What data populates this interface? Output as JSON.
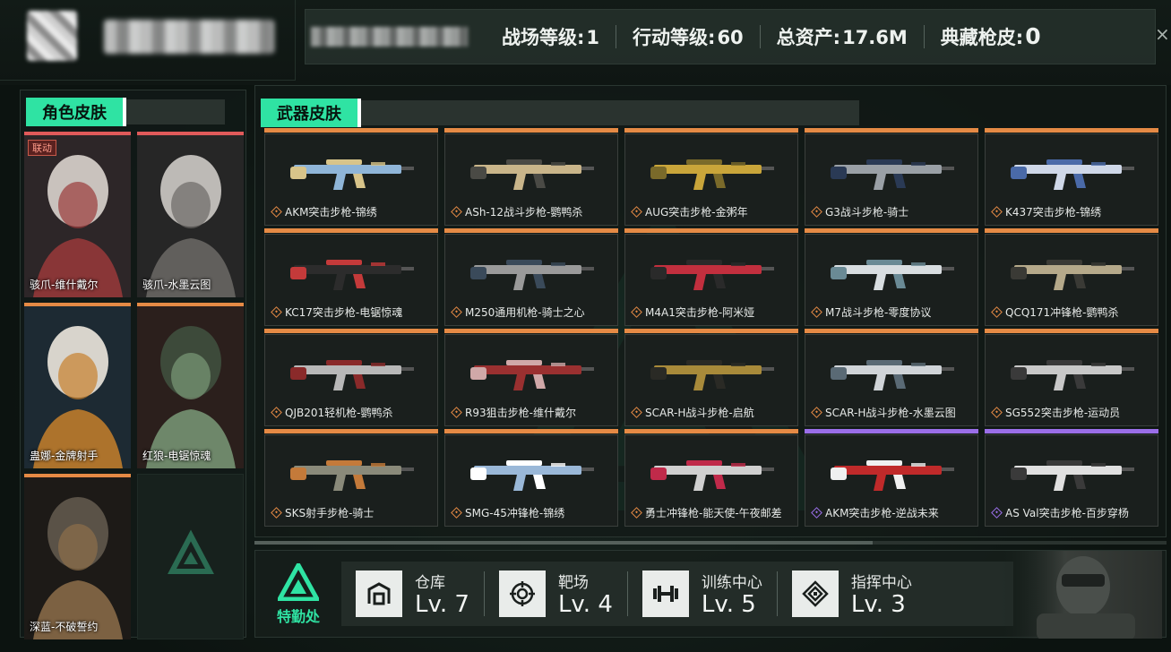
{
  "header": {
    "stats": [
      {
        "label": "战场等级:",
        "value": "1"
      },
      {
        "label": "行动等级:",
        "value": "60"
      },
      {
        "label": "总资产:",
        "value": "17.6M"
      },
      {
        "label": "典藏枪皮:",
        "value": "0"
      }
    ],
    "close_glyph": "×"
  },
  "character_section": {
    "title": "角色皮肤",
    "cards": [
      {
        "label": "骇爪-维什戴尔",
        "badge": "联动",
        "rarity_color": "#e05a5a"
      },
      {
        "label": "骇爪-水墨云图",
        "badge": "",
        "rarity_color": "#e05a5a"
      },
      {
        "label": "蛊娜-金牌射手",
        "badge": "",
        "rarity_color": "#e58a45"
      },
      {
        "label": "红狼-电锯惊魂",
        "badge": "",
        "rarity_color": "#e58a45"
      },
      {
        "label": "深蓝-不破誓约",
        "badge": "",
        "rarity_color": "#e58a45"
      }
    ]
  },
  "weapon_section": {
    "title": "武器皮肤",
    "weapons": [
      {
        "label": "AKM突击步枪-锦绣",
        "rarity": "orange"
      },
      {
        "label": "ASh-12战斗步枪-鹦鸭杀",
        "rarity": "orange"
      },
      {
        "label": "AUG突击步枪-金粥年",
        "rarity": "orange"
      },
      {
        "label": "G3战斗步枪-骑士",
        "rarity": "orange"
      },
      {
        "label": "K437突击步枪-锦绣",
        "rarity": "orange"
      },
      {
        "label": "KC17突击步枪-电锯惊魂",
        "rarity": "orange"
      },
      {
        "label": "M250通用机枪-骑士之心",
        "rarity": "orange"
      },
      {
        "label": "M4A1突击步枪-阿米娅",
        "rarity": "orange"
      },
      {
        "label": "M7战斗步枪-零度协议",
        "rarity": "orange"
      },
      {
        "label": "QCQ171冲锋枪-鹦鸭杀",
        "rarity": "orange"
      },
      {
        "label": "QJB201轻机枪-鹦鸭杀",
        "rarity": "orange"
      },
      {
        "label": "R93狙击步枪-维什戴尔",
        "rarity": "orange"
      },
      {
        "label": "SCAR-H战斗步枪-启航",
        "rarity": "orange"
      },
      {
        "label": "SCAR-H战斗步枪-水墨云图",
        "rarity": "orange"
      },
      {
        "label": "SG552突击步枪-运动员",
        "rarity": "orange"
      },
      {
        "label": "SKS射手步枪-骑士",
        "rarity": "orange"
      },
      {
        "label": "SMG-45冲锋枪-锦绣",
        "rarity": "orange"
      },
      {
        "label": "勇士冲锋枪-能天使-午夜邮差",
        "rarity": "orange"
      },
      {
        "label": "AKM突击步枪-逆战未来",
        "rarity": "purple"
      },
      {
        "label": "AS Val突击步枪-百步穿杨",
        "rarity": "purple"
      }
    ],
    "rarity_colors": {
      "orange": "#e58a45",
      "purple": "#9a6ee8"
    }
  },
  "bottom_bar": {
    "hq_label": "特勤处",
    "facilities": [
      {
        "name": "仓库",
        "level": "Lv. 7",
        "icon": "warehouse-icon"
      },
      {
        "name": "靶场",
        "level": "Lv. 4",
        "icon": "target-icon"
      },
      {
        "name": "训练中心",
        "level": "Lv. 5",
        "icon": "dumbbell-icon"
      },
      {
        "name": "指挥中心",
        "level": "Lv. 3",
        "icon": "command-icon"
      }
    ]
  },
  "accent_color": "#2fe3a3"
}
